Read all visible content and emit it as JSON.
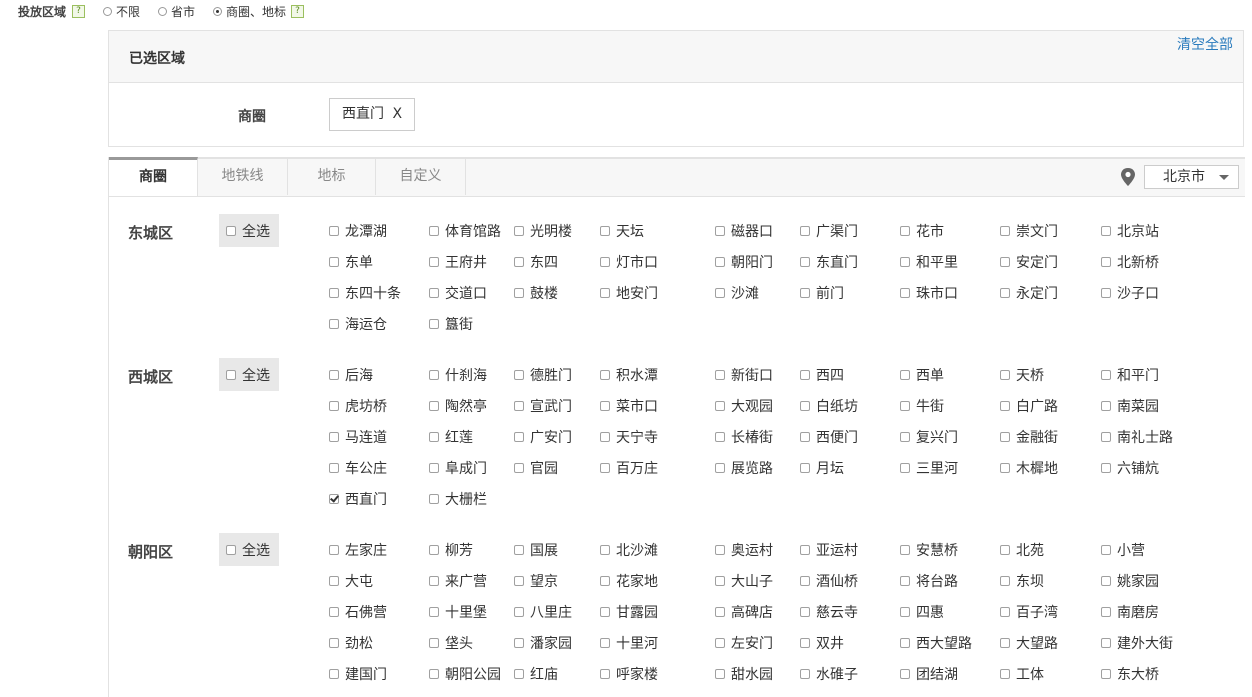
{
  "top": {
    "label": "投放区域",
    "help": "?",
    "options": [
      {
        "label": "不限",
        "selected": false
      },
      {
        "label": "省市",
        "selected": false
      },
      {
        "label": "商圈、地标",
        "selected": true
      }
    ],
    "help2": "?"
  },
  "selected_panel": {
    "title": "已选区域",
    "clear_all": "清空全部",
    "row_label": "商圈",
    "tag": "西直门",
    "tag_remove": "X"
  },
  "tabs": [
    {
      "label": "商圈",
      "active": true
    },
    {
      "label": "地铁线",
      "active": false
    },
    {
      "label": "地标",
      "active": false
    },
    {
      "label": "自定义",
      "active": false
    }
  ],
  "city": {
    "icon": "location-pin-icon",
    "value": "北京市"
  },
  "select_all_label": "全选",
  "districts": [
    {
      "name": "东城区",
      "rows": [
        [
          "龙潭湖",
          "体育馆路",
          "光明楼",
          "天坛",
          "磁器口",
          "广渠门",
          "花市",
          "崇文门",
          "北京站"
        ],
        [
          "东单",
          "王府井",
          "东四",
          "灯市口",
          "朝阳门",
          "东直门",
          "和平里",
          "安定门",
          "北新桥"
        ],
        [
          "东四十条",
          "交道口",
          "鼓楼",
          "地安门",
          "沙滩",
          "前门",
          "珠市口",
          "永定门",
          "沙子口"
        ],
        [
          "海运仓",
          "簋街"
        ]
      ]
    },
    {
      "name": "西城区",
      "rows": [
        [
          "后海",
          "什刹海",
          "德胜门",
          "积水潭",
          "新街口",
          "西四",
          "西单",
          "天桥",
          "和平门"
        ],
        [
          "虎坊桥",
          "陶然亭",
          "宣武门",
          "菜市口",
          "大观园",
          "白纸坊",
          "牛街",
          "白广路",
          "南菜园"
        ],
        [
          "马连道",
          "红莲",
          "广安门",
          "天宁寺",
          "长椿街",
          "西便门",
          "复兴门",
          "金融街",
          "南礼士路"
        ],
        [
          "车公庄",
          "阜成门",
          "官园",
          "百万庄",
          "展览路",
          "月坛",
          "三里河",
          "木樨地",
          "六铺炕"
        ],
        [
          "西直门",
          "大栅栏"
        ]
      ],
      "checked": [
        "西直门"
      ]
    },
    {
      "name": "朝阳区",
      "rows": [
        [
          "左家庄",
          "柳芳",
          "国展",
          "北沙滩",
          "奥运村",
          "亚运村",
          "安慧桥",
          "北苑",
          "小营"
        ],
        [
          "大屯",
          "来广营",
          "望京",
          "花家地",
          "大山子",
          "酒仙桥",
          "将台路",
          "东坝",
          "姚家园"
        ],
        [
          "石佛营",
          "十里堡",
          "八里庄",
          "甘露园",
          "高碑店",
          "慈云寺",
          "四惠",
          "百子湾",
          "南磨房"
        ],
        [
          "劲松",
          "垡头",
          "潘家园",
          "十里河",
          "左安门",
          "双井",
          "西大望路",
          "大望路",
          "建外大街"
        ],
        [
          "建国门",
          "朝阳公园",
          "红庙",
          "呼家楼",
          "甜水园",
          "水碓子",
          "团结湖",
          "工体",
          "东大桥"
        ]
      ]
    }
  ]
}
